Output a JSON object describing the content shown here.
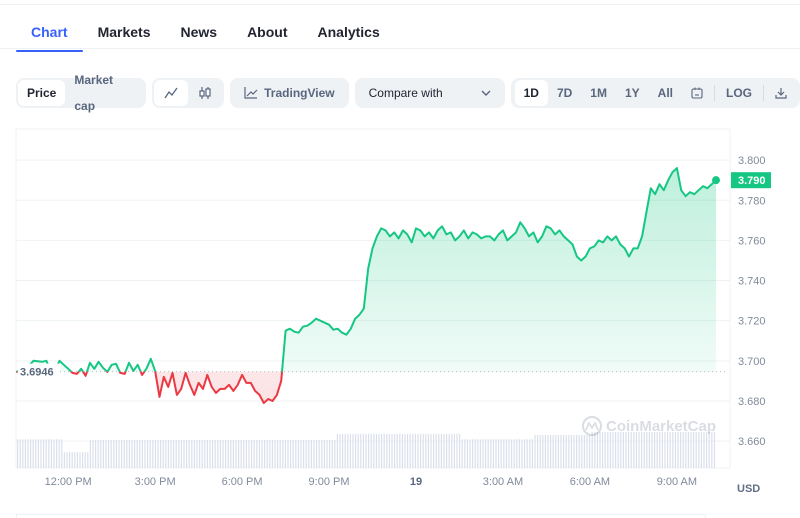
{
  "tabs": [
    {
      "label": "Chart",
      "active": true
    },
    {
      "label": "Markets",
      "active": false
    },
    {
      "label": "News",
      "active": false
    },
    {
      "label": "About",
      "active": false
    },
    {
      "label": "Analytics",
      "active": false
    }
  ],
  "toolbar": {
    "type_toggle": [
      {
        "label": "Price",
        "active": true
      },
      {
        "label": "Market cap",
        "active": false
      }
    ],
    "chart_style": [
      {
        "icon": "line-chart-icon",
        "active": true
      },
      {
        "icon": "candlestick-icon",
        "active": false
      }
    ],
    "tradingview_label": "TradingView",
    "compare_label": "Compare with",
    "ranges": [
      {
        "label": "1D",
        "active": true
      },
      {
        "label": "7D",
        "active": false
      },
      {
        "label": "1M",
        "active": false
      },
      {
        "label": "1Y",
        "active": false
      },
      {
        "label": "All",
        "active": false
      }
    ],
    "log_label": "LOG"
  },
  "colors": {
    "accent": "#3861fb",
    "up": "#16c784",
    "down": "#ea3943",
    "grid": "#eff2f5",
    "volume": "#cfd6e4"
  },
  "chart_data": {
    "type": "area",
    "title": "",
    "xlabel": "",
    "ylabel": "USD",
    "currency_label": "USD",
    "watermark": "CoinMarketCap",
    "baseline_value": 3.6946,
    "baseline_label": "3.6946",
    "current_value": 3.79,
    "current_label": "3.790",
    "ylim": [
      3.6466,
      3.8155
    ],
    "yticks": [
      3.8,
      3.78,
      3.76,
      3.74,
      3.72,
      3.7,
      3.68,
      3.66
    ],
    "ytick_labels": [
      "3.800",
      "3.780",
      "3.760",
      "3.740",
      "3.720",
      "3.700",
      "3.680",
      "3.660"
    ],
    "x_unit": "hours since 12:00 PM",
    "xlim": [
      -1.8,
      22.35
    ],
    "xticks": [
      0,
      3,
      6,
      9,
      12,
      15,
      18,
      21
    ],
    "xtick_labels": [
      "12:00 PM",
      "3:00 PM",
      "6:00 PM",
      "9:00 PM",
      "19",
      "3:00 AM",
      "6:00 AM",
      "9:00 AM"
    ],
    "xtick_bold": [
      false,
      false,
      false,
      false,
      true,
      false,
      false,
      false
    ],
    "grid": true,
    "price": {
      "x": [
        -1.8,
        -1.5,
        -1.2,
        -0.9,
        -0.75,
        -0.6,
        -0.45,
        -0.3,
        -0.15,
        0.0,
        0.15,
        0.3,
        0.45,
        0.6,
        0.75,
        0.9,
        1.05,
        1.2,
        1.35,
        1.5,
        1.65,
        1.8,
        1.95,
        2.1,
        2.25,
        2.4,
        2.55,
        2.7,
        2.85,
        3.0,
        3.15,
        3.3,
        3.45,
        3.6,
        3.75,
        3.9,
        4.05,
        4.2,
        4.35,
        4.5,
        4.65,
        4.8,
        4.95,
        5.1,
        5.25,
        5.4,
        5.55,
        5.7,
        5.85,
        6.0,
        6.15,
        6.3,
        6.45,
        6.6,
        6.75,
        6.9,
        7.05,
        7.2,
        7.35,
        7.5,
        7.65,
        7.8,
        7.95,
        8.1,
        8.25,
        8.4,
        8.55,
        8.7,
        8.85,
        9.0,
        9.15,
        9.3,
        9.45,
        9.6,
        9.75,
        9.9,
        10.05,
        10.2,
        10.35,
        10.5,
        10.65,
        10.8,
        10.95,
        11.1,
        11.25,
        11.4,
        11.55,
        11.7,
        11.85,
        12.0,
        12.15,
        12.3,
        12.45,
        12.6,
        12.75,
        12.9,
        13.05,
        13.2,
        13.35,
        13.5,
        13.65,
        13.8,
        13.95,
        14.1,
        14.25,
        14.4,
        14.55,
        14.7,
        14.85,
        15.0,
        15.15,
        15.3,
        15.45,
        15.6,
        15.75,
        15.9,
        16.05,
        16.2,
        16.35,
        16.5,
        16.65,
        16.8,
        16.95,
        17.1,
        17.25,
        17.4,
        17.55,
        17.7,
        17.85,
        18.0,
        18.15,
        18.3,
        18.45,
        18.6,
        18.75,
        18.9,
        19.05,
        19.2,
        19.35,
        19.5,
        19.65,
        19.8,
        19.95,
        20.1,
        20.25,
        20.4,
        20.55,
        20.7,
        20.85,
        21.0,
        21.15,
        21.3,
        21.45,
        21.6,
        21.75,
        21.9,
        22.05,
        22.2,
        22.35
      ],
      "y": [
        3.6946,
        3.695,
        3.7,
        3.6995,
        3.7,
        3.6945,
        3.695,
        3.7,
        3.698,
        3.696,
        3.694,
        3.6935,
        3.696,
        3.6925,
        3.699,
        3.696,
        3.6995,
        3.6965,
        3.6945,
        3.698,
        3.6985,
        3.694,
        3.6935,
        3.699,
        3.695,
        3.698,
        3.693,
        3.696,
        3.701,
        3.695,
        3.682,
        3.692,
        3.687,
        3.694,
        3.683,
        3.686,
        3.694,
        3.688,
        3.683,
        3.689,
        3.686,
        3.693,
        3.687,
        3.684,
        3.686,
        3.686,
        3.688,
        3.685,
        3.688,
        3.693,
        3.689,
        3.689,
        3.685,
        3.683,
        3.679,
        3.681,
        3.68,
        3.683,
        3.69,
        3.715,
        3.716,
        3.7145,
        3.714,
        3.717,
        3.7175,
        3.719,
        3.721,
        3.72,
        3.719,
        3.718,
        3.7155,
        3.716,
        3.714,
        3.713,
        3.716,
        3.721,
        3.723,
        3.726,
        3.746,
        3.756,
        3.762,
        3.766,
        3.765,
        3.762,
        3.764,
        3.761,
        3.765,
        3.763,
        3.759,
        3.766,
        3.765,
        3.762,
        3.764,
        3.761,
        3.765,
        3.767,
        3.763,
        3.764,
        3.76,
        3.762,
        3.765,
        3.761,
        3.764,
        3.763,
        3.761,
        3.762,
        3.762,
        3.76,
        3.763,
        3.765,
        3.76,
        3.762,
        3.764,
        3.769,
        3.766,
        3.762,
        3.764,
        3.759,
        3.762,
        3.767,
        3.766,
        3.763,
        3.765,
        3.762,
        3.76,
        3.758,
        3.752,
        3.75,
        3.752,
        3.756,
        3.757,
        3.76,
        3.759,
        3.762,
        3.76,
        3.762,
        3.758,
        3.756,
        3.752,
        3.756,
        3.756,
        3.762,
        3.774,
        3.786,
        3.783,
        3.788,
        3.785,
        3.79,
        3.794,
        3.796,
        3.785,
        3.782,
        3.784,
        3.783,
        3.785,
        3.787,
        3.786,
        3.788,
        3.79
      ]
    },
    "volume": {
      "x_bins": "hourly segments",
      "relative_levels": [
        {
          "from": -1.8,
          "to": -0.2,
          "value": 0.8
        },
        {
          "from": -0.2,
          "to": 0.7,
          "value": 0.44
        },
        {
          "from": 0.7,
          "to": 9.2,
          "value": 0.78
        },
        {
          "from": 9.2,
          "to": 13.5,
          "value": 0.95
        },
        {
          "from": 13.5,
          "to": 16.0,
          "value": 0.8
        },
        {
          "from": 16.0,
          "to": 18.0,
          "value": 0.92
        },
        {
          "from": 18.0,
          "to": 22.35,
          "value": 1.0
        }
      ]
    }
  }
}
